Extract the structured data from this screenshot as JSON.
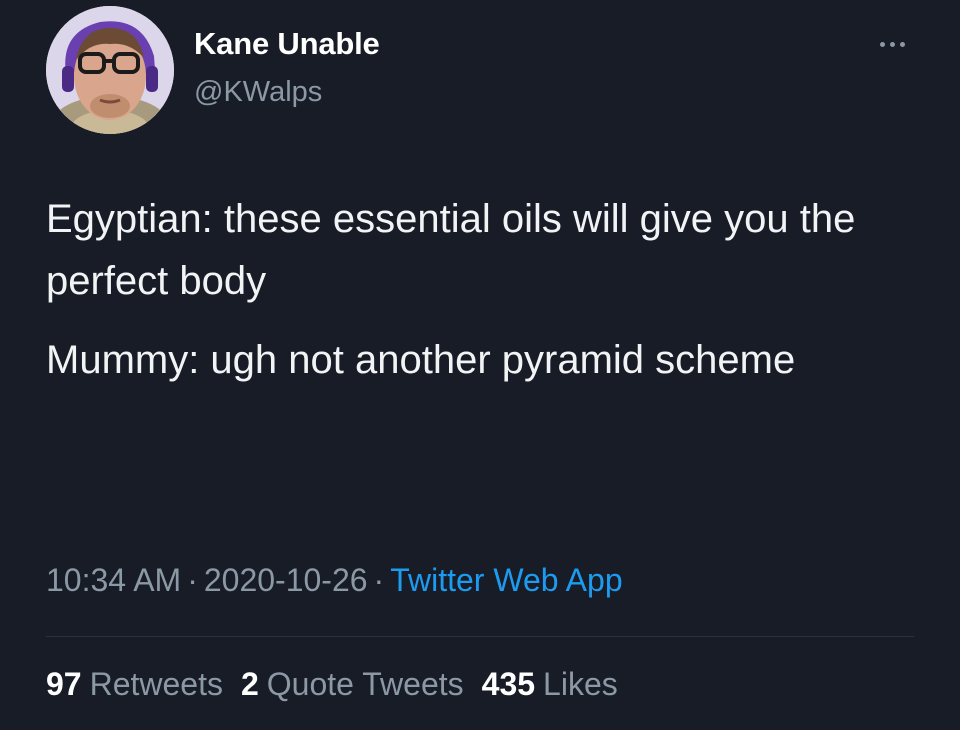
{
  "user": {
    "display_name": "Kane Unable",
    "handle": "@KWalps",
    "avatar_icon": "user-avatar-photo"
  },
  "tweet": {
    "lines": [
      "Egyptian: these essential oils will give you the perfect body",
      "Mummy: ugh not another pyramid scheme"
    ]
  },
  "meta": {
    "time": "10:34 AM",
    "separator": "·",
    "date": "2020-10-26",
    "source": "Twitter Web App"
  },
  "stats": {
    "retweets_count": "97",
    "retweets_label": "Retweets",
    "quote_count": "2",
    "quote_label": "Quote Tweets",
    "likes_count": "435",
    "likes_label": "Likes"
  },
  "colors": {
    "background": "#181c26",
    "accent": "#1d9bf0",
    "muted": "#8b98a5"
  }
}
